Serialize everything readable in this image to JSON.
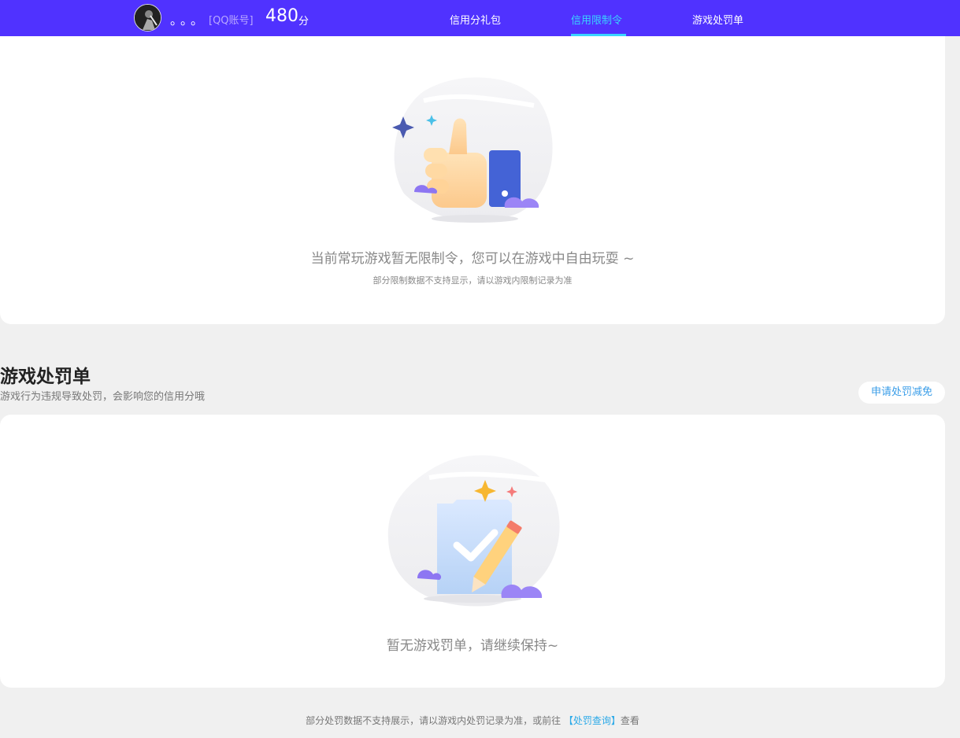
{
  "header": {
    "username": "。。。",
    "account_type": "[QQ账号]",
    "score": "480",
    "score_unit": "分",
    "tabs": [
      {
        "label": "信用分礼包",
        "active": false
      },
      {
        "label": "信用限制令",
        "active": true
      },
      {
        "label": "游戏处罚单",
        "active": false
      }
    ]
  },
  "restriction": {
    "empty_title": "当前常玩游戏暂无限制令，您可以在游戏中自由玩耍 ~",
    "empty_note": "部分限制数据不支持显示，请以游戏内限制记录为准",
    "icon": "thumbs-up-illustration"
  },
  "penalty": {
    "title": "游戏处罚单",
    "description": "游戏行为违规导致处罚，会影响您的信用分哦",
    "appeal_button": "申请处罚减免",
    "empty_title": "暂无游戏罚单，请继续保持~",
    "icon": "checklist-pencil-illustration"
  },
  "footer": {
    "text": "部分处罚数据不支持展示，请以游戏内处罚记录为准，或前往",
    "link": "【处罚查询】",
    "suffix": "查看"
  },
  "colors": {
    "header_bg": "#5032ff",
    "accent": "#3ad3ff",
    "link": "#2aa9e8"
  }
}
